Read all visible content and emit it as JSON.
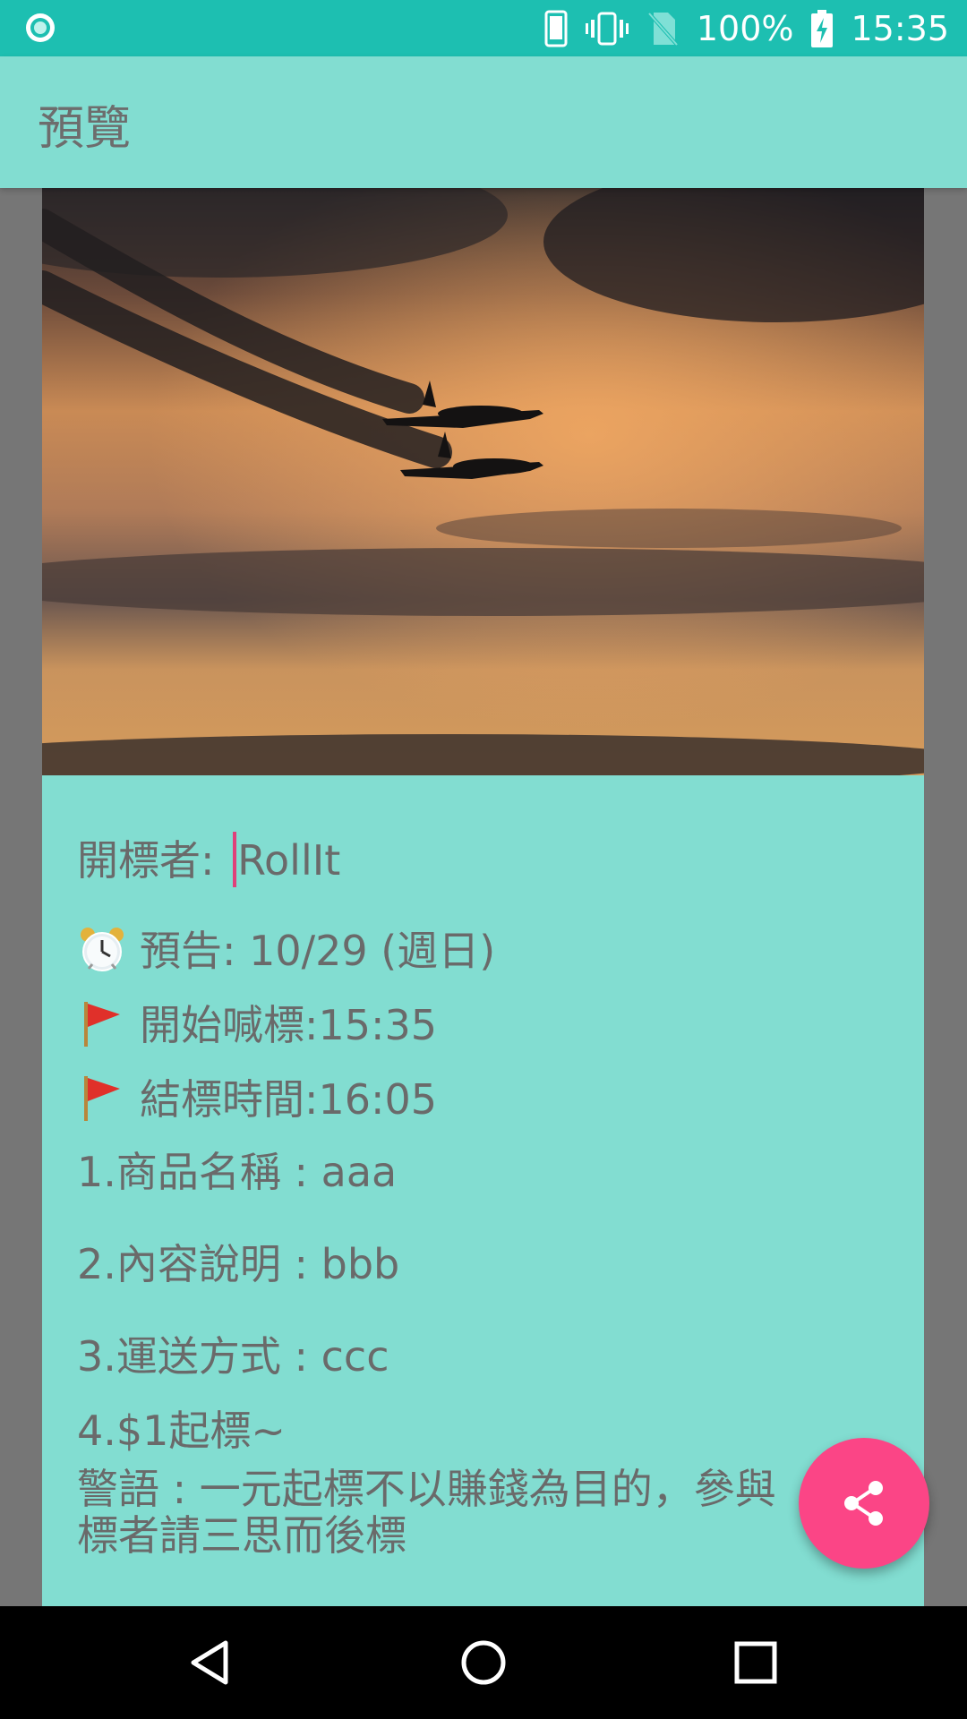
{
  "status_bar": {
    "battery": "100%",
    "time": "15:35",
    "icons": [
      "app-notification-icon",
      "phone-icon",
      "vibrate-icon",
      "no-sim-icon",
      "battery-charging-icon"
    ]
  },
  "app_bar": {
    "title": "預覽"
  },
  "post": {
    "photo_description": "two-planes-sunset-photo",
    "bidder_label": "開標者: ",
    "bidder_name": "RollIt",
    "preview": "預告: 10/29 (週日)",
    "start": "開始喊標:15:35",
    "end": "結標時間:16:05",
    "item_name": "1.商品名稱 : aaa",
    "description": "2.內容說明 : bbb",
    "shipping": "3.運送方式 : ccc",
    "start_price": "4.$1起標~",
    "warning": "警語 : 一元起標不以賺錢為目的，參與標者請三思而後標"
  },
  "fab": {
    "icon": "share-icon"
  },
  "nav_bar": {
    "icons": [
      "back-icon",
      "home-icon",
      "recents-icon"
    ]
  },
  "colors": {
    "status_bar": "#1dbfb1",
    "app_bar": "#82ddd1",
    "fab": "#fb4586",
    "text": "#6a6a6a"
  }
}
